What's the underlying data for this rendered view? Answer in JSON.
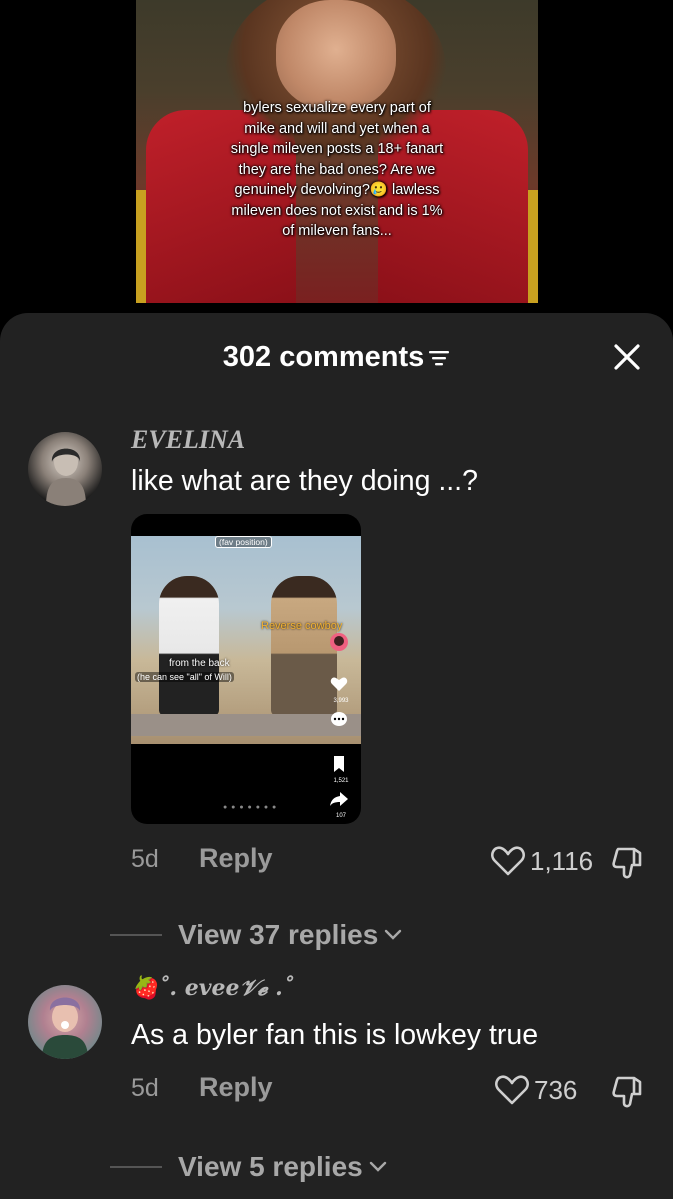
{
  "video": {
    "caption": "bylers sexualize every part of mike and will and yet when a single mileven posts a 18+ fanart they are the bad ones? Are we genuinely devolving?🥲 lawless mileven does not exist and is 1% of mileven fans..."
  },
  "comments_header": {
    "title": "302 comments",
    "filter_icon": "filter-icon",
    "close_icon": "close-icon"
  },
  "comments": [
    {
      "username": "EVELINA",
      "text": "like what are they doing ...?",
      "time": "5d",
      "reply_label": "Reply",
      "likes": "1,116",
      "view_replies": "View 37 replies",
      "media": {
        "tag_top": "(fav position)",
        "tag_reverse_cowboy": "Reverse cowboy",
        "tag_from_the_back": "from the back",
        "tag_he_can_see": "(he can see \"all\" of Will)",
        "stat_likes": "3,993",
        "stat_saves": "1,521",
        "stat_shares": "107"
      }
    },
    {
      "username": "🍓˚. evee𝒱𝓮 .˚",
      "text": "As a byler fan this is lowkey true",
      "time": "5d",
      "reply_label": "Reply",
      "likes": "736",
      "view_replies": "View 5 replies"
    }
  ],
  "colors": {
    "sheet_bg": "#222222",
    "page_bg": "#000000",
    "muted_text": "#9a9a9a"
  }
}
